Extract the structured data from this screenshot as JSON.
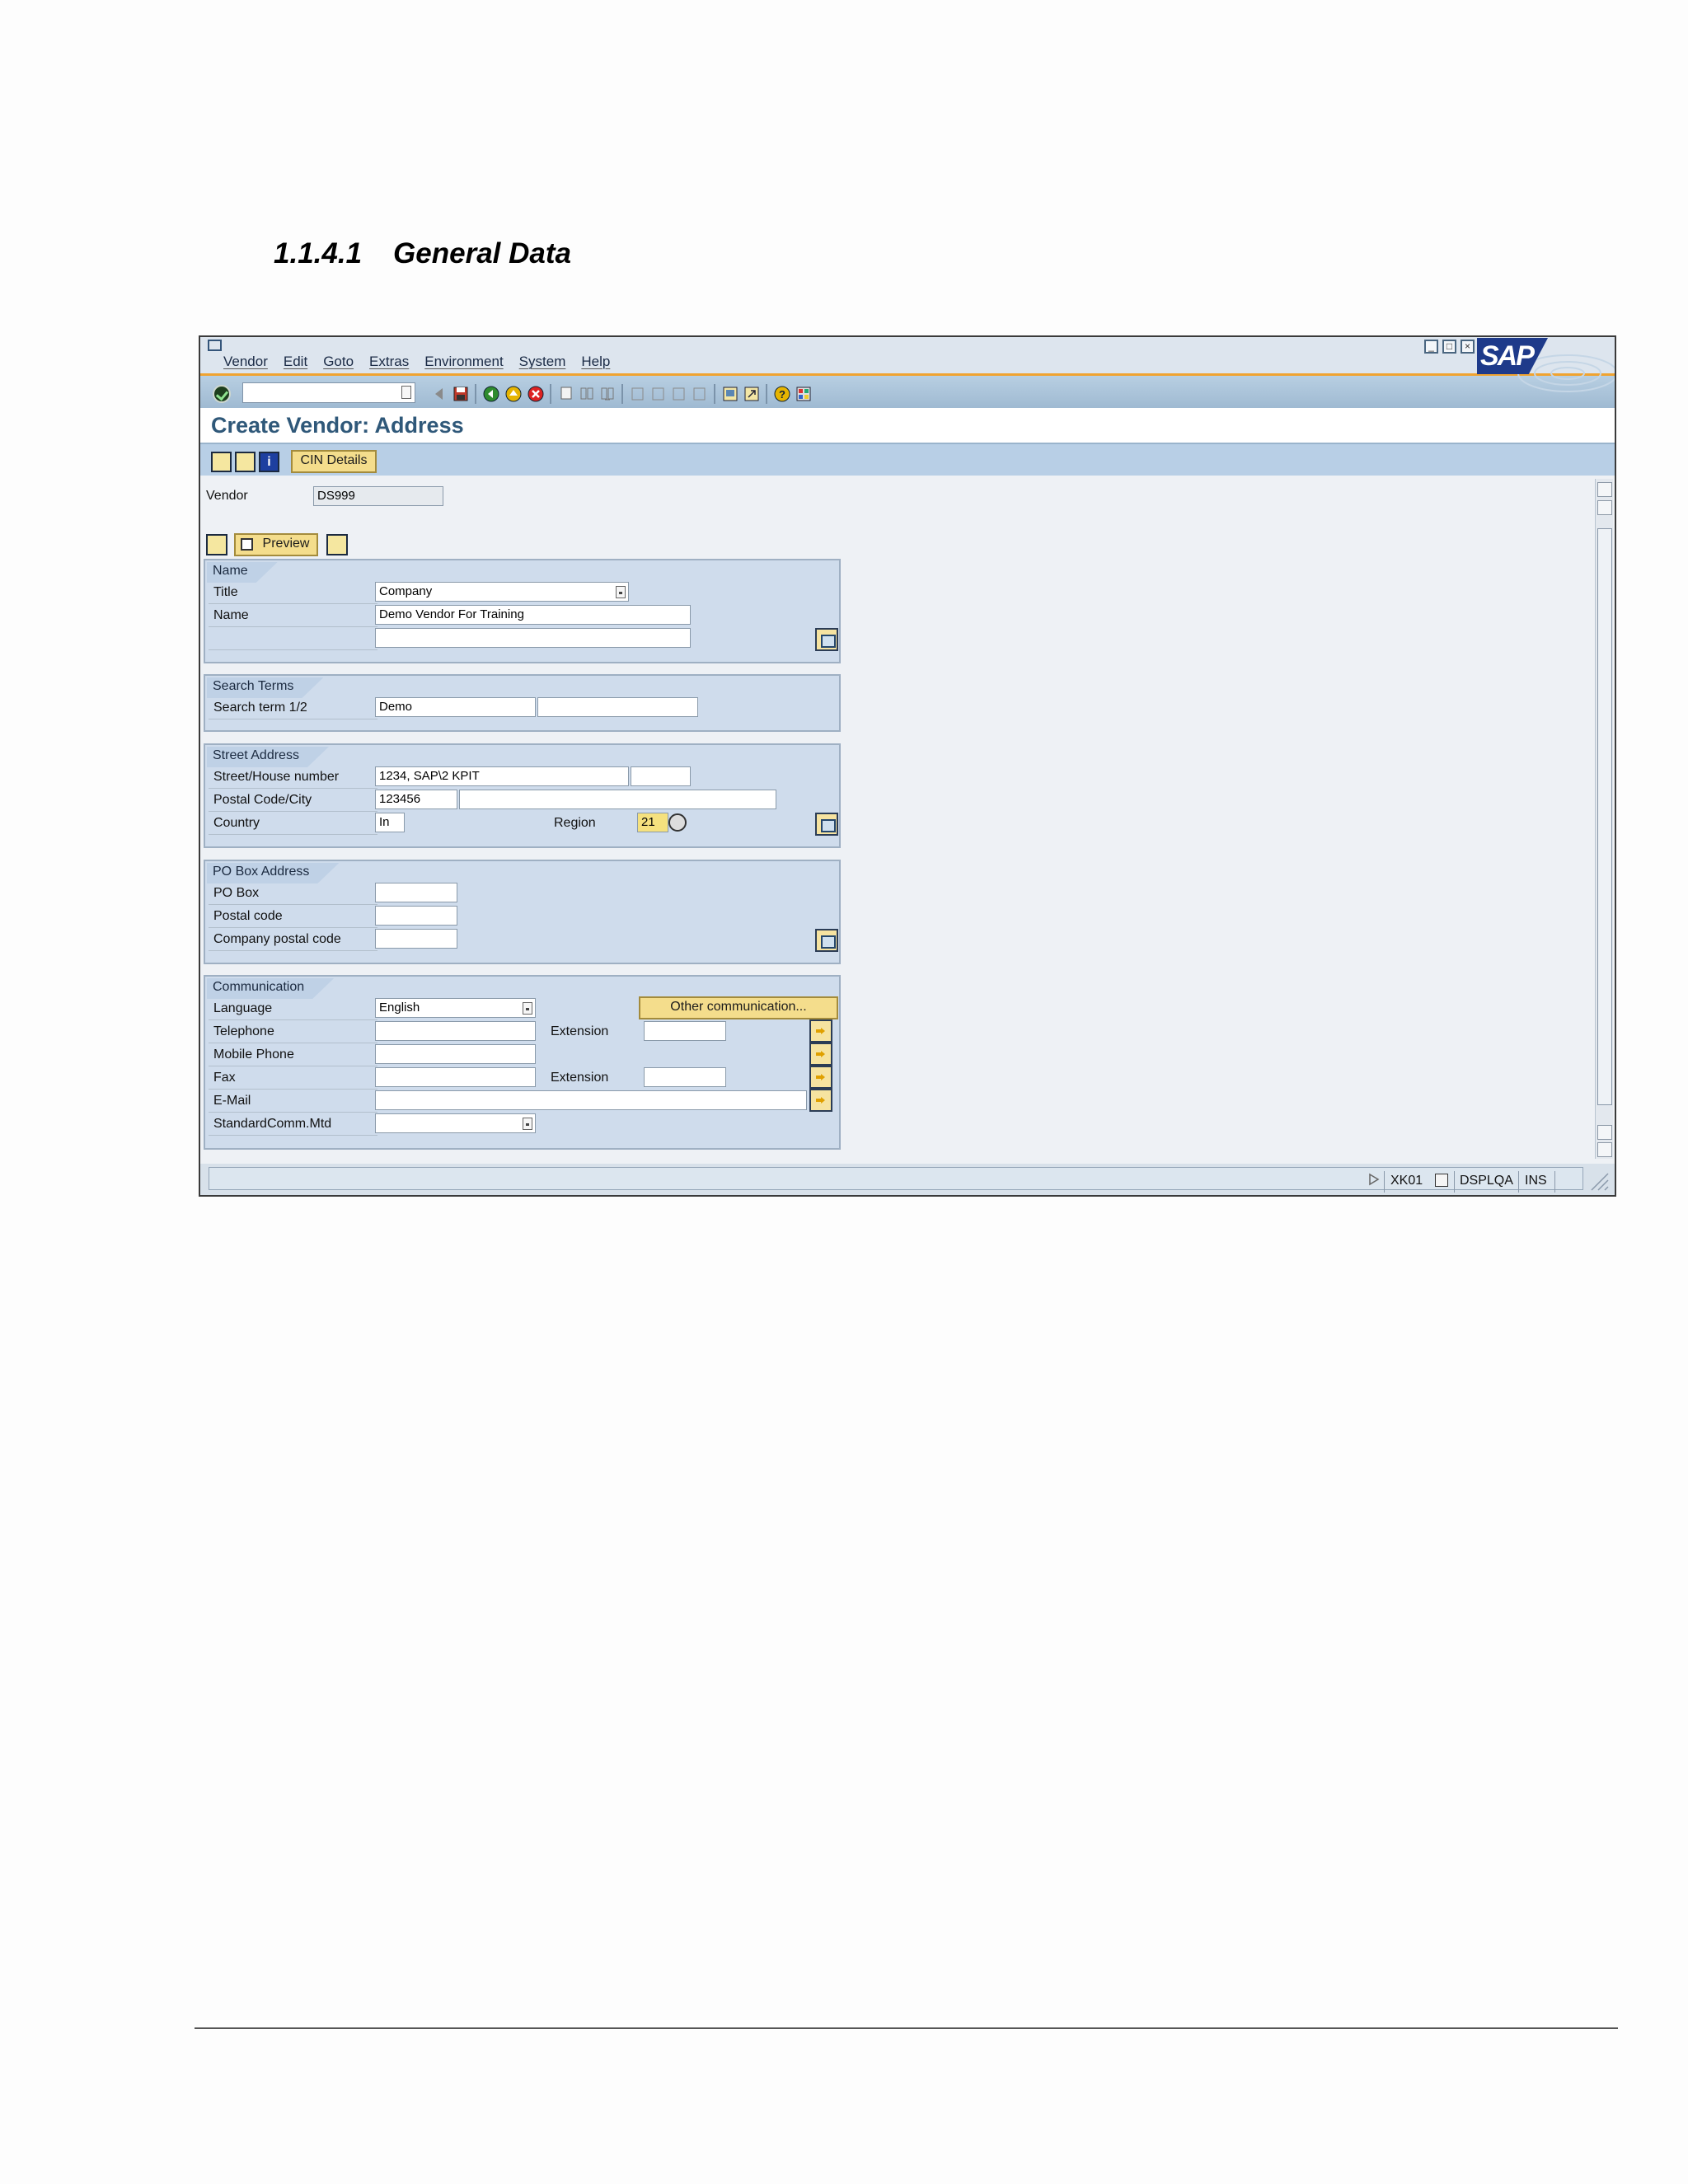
{
  "heading": {
    "number": "1.1.4.1",
    "title": "General Data"
  },
  "menu": [
    "Vendor",
    "Edit",
    "Goto",
    "Extras",
    "Environment",
    "System",
    "Help"
  ],
  "logo": "SAP",
  "page_title": "Create Vendor: Address",
  "app_toolbar": {
    "cin_details": "CIN Details"
  },
  "vendor": {
    "label": "Vendor",
    "value": "DS999"
  },
  "preview_label": "Preview",
  "name_group": {
    "title": "Name",
    "title_label": "Title",
    "title_value": "Company",
    "name_label": "Name",
    "name_value": "Demo Vendor For Training"
  },
  "search_terms": {
    "title": "Search Terms",
    "label": "Search term 1/2",
    "value1": "Demo",
    "value2": ""
  },
  "street": {
    "title": "Street Address",
    "street_label": "Street/House number",
    "street_value": "1234, SAP\\2 KPIT",
    "postal_label": "Postal Code/City",
    "postal_value": "123456",
    "country_label": "Country",
    "country_value": "In",
    "region_label": "Region",
    "region_value": "21"
  },
  "pobox": {
    "title": "PO Box Address",
    "pobox_label": "PO Box",
    "postal_label": "Postal code",
    "company_postal_label": "Company postal code"
  },
  "comm": {
    "title": "Communication",
    "language_label": "Language",
    "language_value": "English",
    "other_btn": "Other communication...",
    "telephone_label": "Telephone",
    "extension_label": "Extension",
    "mobile_label": "Mobile Phone",
    "fax_label": "Fax",
    "fax_extension_label": "Extension",
    "email_label": "E-Mail",
    "std_label": "StandardComm.Mtd"
  },
  "status": {
    "tcode": "XK01",
    "system": "DSPLQA",
    "mode": "INS"
  },
  "colors": {
    "accent": "#2f5879",
    "toolbar_stripe": "#f0a330",
    "button_yellow": "#f4dd8c",
    "group_bg": "#cfdcec"
  }
}
